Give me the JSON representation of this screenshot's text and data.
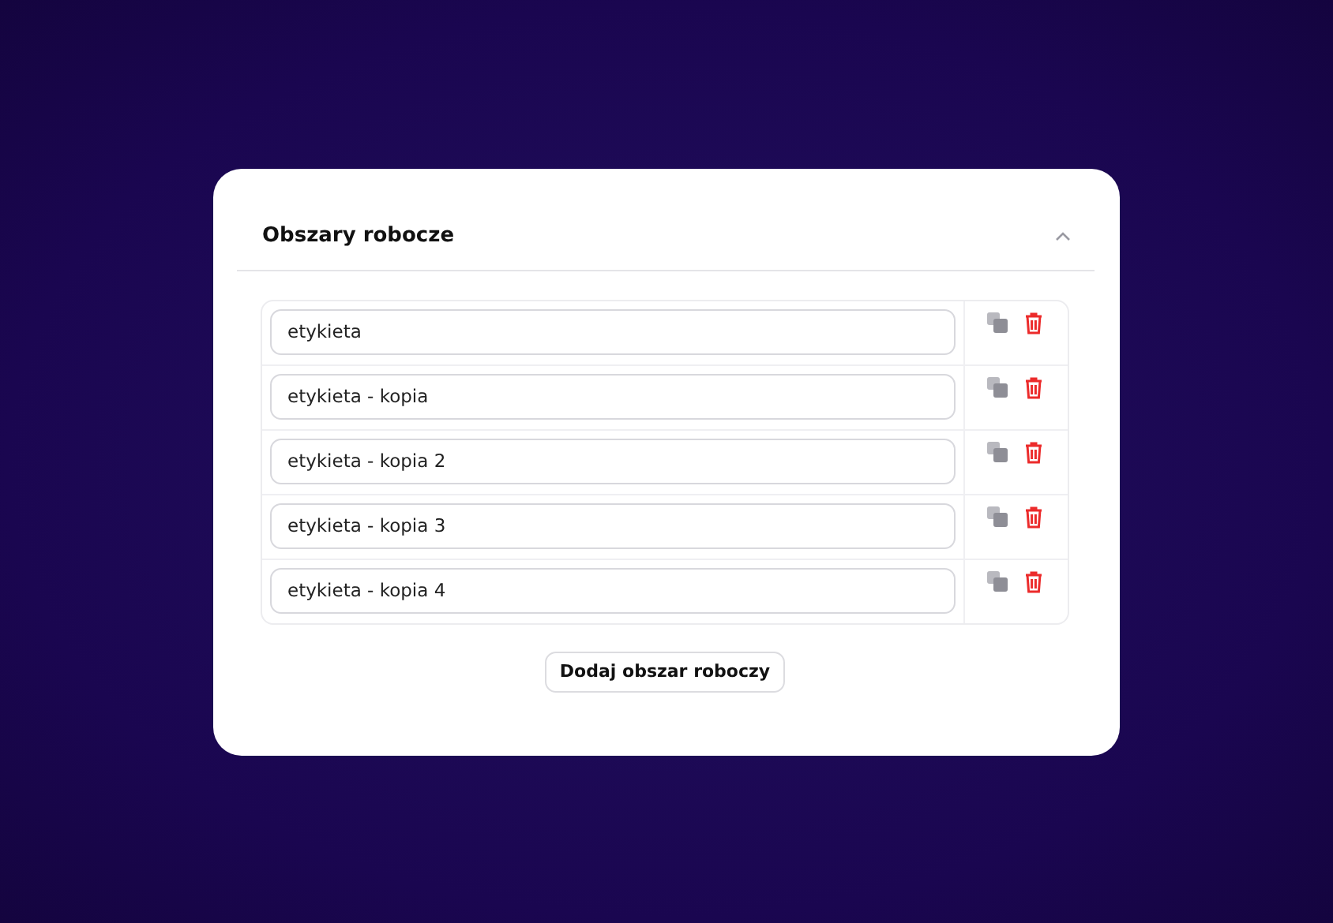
{
  "section": {
    "title": "Obszary robocze",
    "expanded": true
  },
  "workspaces": [
    {
      "value": "etykieta"
    },
    {
      "value": "etykieta - kopia"
    },
    {
      "value": "etykieta - kopia 2"
    },
    {
      "value": "etykieta - kopia 3"
    },
    {
      "value": "etykieta - kopia 4"
    }
  ],
  "add_button": "Dodaj obszar roboczy"
}
